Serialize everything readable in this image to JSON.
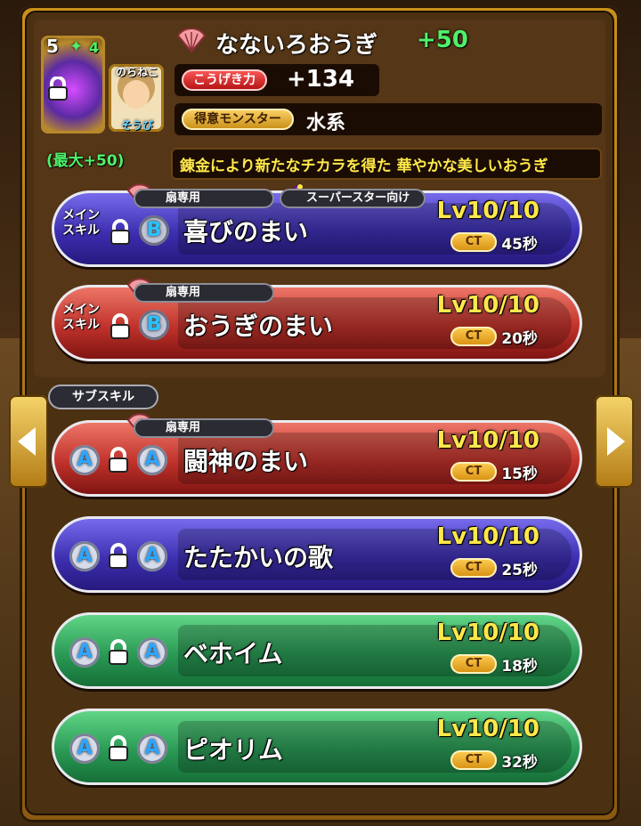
{
  "item": {
    "rarity": "5",
    "plus_icon": "sparkle-icon",
    "plus_count": "4",
    "max_bonus": "(最大+50)",
    "name": "なないろおうぎ",
    "plus": "+50",
    "avatar_name": "のらねこ",
    "avatar_label": "そうび",
    "stat_label": "こうげき力",
    "stat_value": "+134",
    "type_label": "得意モンスター",
    "type_value": "水系",
    "description": "錬金により新たなチカラを得た 華やかな美しいおうぎ"
  },
  "main_skills": [
    {
      "tag": "メイン\nスキル",
      "rank": "B",
      "name": "喜びのまい",
      "level": "Lv10/10",
      "ct_label": "CT",
      "ct_value": "45秒",
      "restriction": "扇専用",
      "target": "スーパースター向け",
      "color": "#5a4bd6"
    },
    {
      "tag": "メイン\nスキル",
      "rank": "B",
      "name": "おうぎのまい",
      "level": "Lv10/10",
      "ct_label": "CT",
      "ct_value": "20秒",
      "restriction": "扇専用",
      "color": "#c0322b"
    }
  ],
  "sub_skill_tab": "サブスキル",
  "sub_skills": [
    {
      "rank_left": "A",
      "rank_right": "A",
      "name": "闘神のまい",
      "level": "Lv10/10",
      "ct_label": "CT",
      "ct_value": "15秒",
      "restriction": "扇専用",
      "color": "#c0322b"
    },
    {
      "rank_left": "A",
      "rank_right": "A",
      "name": "たたかいの歌",
      "level": "Lv10/10",
      "ct_label": "CT",
      "ct_value": "25秒",
      "color": "#5a4bd6"
    },
    {
      "rank_left": "A",
      "rank_right": "A",
      "name": "ベホイム",
      "level": "Lv10/10",
      "ct_label": "CT",
      "ct_value": "18秒",
      "color": "#2a9a55"
    },
    {
      "rank_left": "A",
      "rank_right": "A",
      "name": "ピオリム",
      "level": "Lv10/10",
      "ct_label": "CT",
      "ct_value": "32秒",
      "color": "#2a9a55"
    }
  ],
  "nav": {
    "prev_icon": "chevron-left-icon",
    "next_icon": "chevron-right-icon"
  }
}
